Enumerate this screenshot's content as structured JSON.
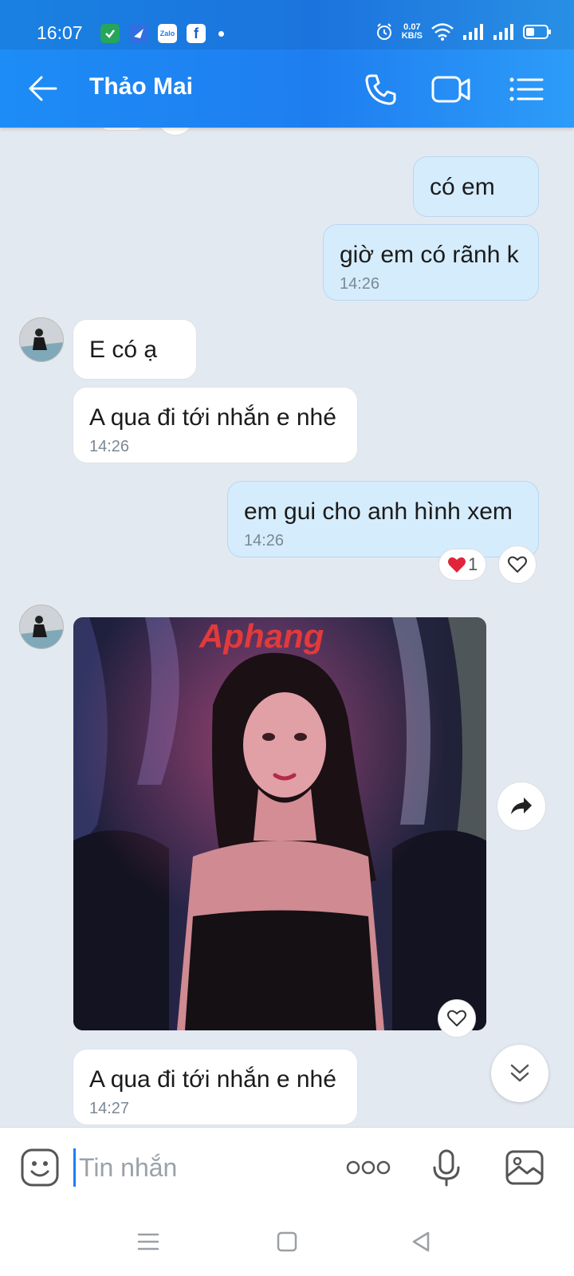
{
  "status_bar": {
    "time": "16:07",
    "speed_value": "0.07",
    "speed_unit": "KB/S",
    "icons": [
      "task-app-icon",
      "messenger-app-icon",
      "zalo-app-icon",
      "facebook-app-icon",
      "alarm-icon",
      "wifi-icon",
      "signal-icon",
      "signal-icon",
      "battery-icon"
    ],
    "zalo_label": "Zalo"
  },
  "header": {
    "title": "Thảo Mai",
    "icons": [
      "back-arrow-icon",
      "phone-icon",
      "video-call-icon",
      "menu-list-icon"
    ]
  },
  "messages": [
    {
      "direction": "out",
      "text": "có em",
      "time": ""
    },
    {
      "direction": "out",
      "text": "giờ em có rãnh k",
      "time": "14:26"
    },
    {
      "direction": "in",
      "text": "E có ạ",
      "time": ""
    },
    {
      "direction": "in",
      "text": "A qua đi tới nhắn e nhé",
      "time": "14:26"
    },
    {
      "direction": "out",
      "text": "em gui cho anh hình xem",
      "time": "14:26",
      "reaction_count": "1"
    },
    {
      "direction": "in",
      "type": "image",
      "watermark": "Aphang"
    },
    {
      "direction": "in",
      "text": "A qua đi tới nhắn e nhé",
      "time": "14:27"
    }
  ],
  "composer": {
    "placeholder": "Tin nhắn",
    "icons": [
      "sticker-icon",
      "more-options-icon",
      "microphone-icon",
      "image-picker-icon"
    ]
  },
  "colors": {
    "header_blue": "#1e7ef0",
    "outgoing_bubble": "#d5ecfc",
    "incoming_bubble": "#ffffff",
    "chat_background": "#e3e9f0",
    "heart_red": "#e0253b"
  }
}
